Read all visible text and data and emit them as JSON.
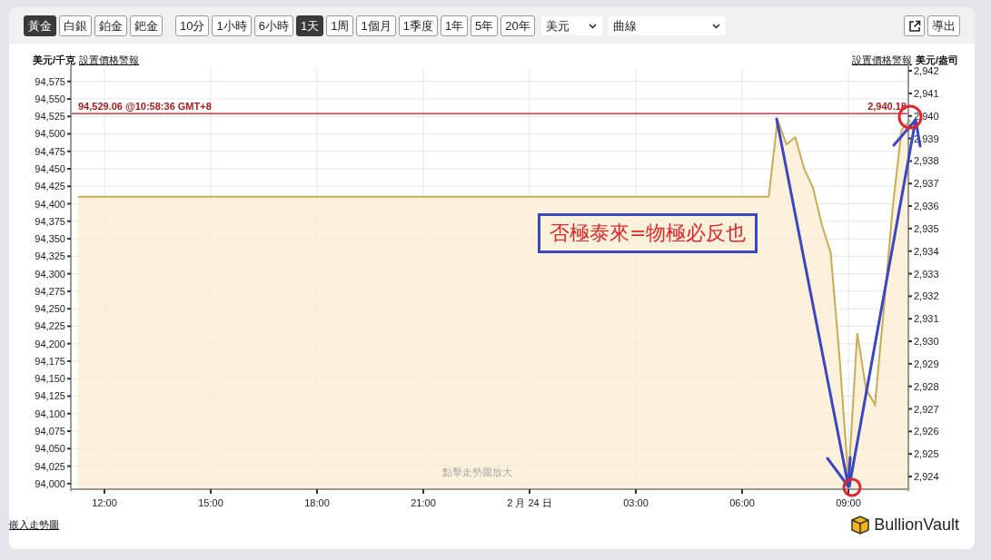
{
  "toolbar": {
    "metals": [
      {
        "label": "黃金",
        "selected": true
      },
      {
        "label": "白銀",
        "selected": false
      },
      {
        "label": "鉑金",
        "selected": false
      },
      {
        "label": "鈀金",
        "selected": false
      }
    ],
    "periods": [
      {
        "label": "10分",
        "selected": false
      },
      {
        "label": "1小時",
        "selected": false
      },
      {
        "label": "6小時",
        "selected": false
      },
      {
        "label": "1天",
        "selected": true
      },
      {
        "label": "1周",
        "selected": false
      },
      {
        "label": "1個月",
        "selected": false
      },
      {
        "label": "1季度",
        "selected": false
      },
      {
        "label": "1年",
        "selected": false
      },
      {
        "label": "5年",
        "selected": false
      },
      {
        "label": "20年",
        "selected": false
      }
    ],
    "currency_select": {
      "value": "美元"
    },
    "chart_type_select": {
      "value": "曲線"
    },
    "export_button": {
      "label": "導出"
    }
  },
  "header": {
    "left_unit": "美元/千克",
    "left_alert_link": "設置價格警報",
    "right_alert_link": "設置價格警報",
    "right_unit": "美元/盎司"
  },
  "chart": {
    "price_line": {
      "right_label": "2,940.18"
    },
    "hint": "點擊走勢圖放大",
    "right_ticks": [
      "2,942",
      "2,941",
      "2,940",
      "2,939",
      "2,938",
      "2,937",
      "2,936",
      "2,935",
      "2,934",
      "2,933",
      "2,932",
      "2,931",
      "2,930",
      "2,929",
      "2,928",
      "2,927",
      "2,926",
      "2,925",
      "2,924"
    ],
    "chart_data": {
      "type": "area",
      "grid": true,
      "ref_lines": [
        {
          "axis": "y",
          "value": 94529.06,
          "label": "94,529.06 @10:58:36 GMT+8",
          "color": "#a61c1c"
        }
      ],
      "categories": [
        null,
        null,
        null,
        "12:00",
        null,
        null,
        null,
        null,
        null,
        null,
        null,
        null,
        null,
        null,
        null,
        "15:00",
        null,
        null,
        null,
        null,
        null,
        null,
        null,
        null,
        null,
        null,
        null,
        "18:00",
        null,
        null,
        null,
        null,
        null,
        null,
        null,
        null,
        null,
        null,
        null,
        "21:00",
        null,
        null,
        null,
        null,
        null,
        null,
        null,
        null,
        null,
        null,
        null,
        "2 月 24 日",
        null,
        null,
        null,
        null,
        null,
        null,
        null,
        null,
        null,
        null,
        null,
        "03:00",
        null,
        null,
        null,
        null,
        null,
        null,
        null,
        null,
        null,
        null,
        null,
        "06:00",
        null,
        null,
        null,
        null,
        null,
        null,
        null,
        null,
        null,
        null,
        null,
        "09:00",
        null,
        null,
        null,
        null,
        null,
        null,
        null
      ],
      "values": [
        94410,
        94410,
        94410,
        94410,
        94410,
        94410,
        94410,
        94410,
        94410,
        94410,
        94410,
        94410,
        94410,
        94410,
        94410,
        94410,
        94410,
        94410,
        94410,
        94410,
        94410,
        94410,
        94410,
        94410,
        94410,
        94410,
        94410,
        94410,
        94410,
        94410,
        94410,
        94410,
        94410,
        94410,
        94410,
        94410,
        94410,
        94410,
        94410,
        94410,
        94410,
        94410,
        94410,
        94410,
        94410,
        94410,
        94410,
        94410,
        94410,
        94410,
        94410,
        94410,
        94410,
        94410,
        94410,
        94410,
        94410,
        94410,
        94410,
        94410,
        94410,
        94410,
        94410,
        94410,
        94410,
        94410,
        94410,
        94410,
        94410,
        94410,
        94410,
        94410,
        94410,
        94410,
        94410,
        94410,
        94410,
        94410,
        94410,
        94520,
        94485,
        94495,
        94450,
        94423,
        94370,
        94330,
        94180,
        94005,
        94215,
        94135,
        94113,
        94250,
        94395,
        94505,
        94520
      ],
      "ylim": [
        93992,
        94594
      ],
      "yticks": [
        {
          "value": 94000,
          "label": "94,000"
        },
        {
          "value": 94025,
          "label": "94,025"
        },
        {
          "value": 94050,
          "label": "94,050"
        },
        {
          "value": 94075,
          "label": "94,075"
        },
        {
          "value": 94100,
          "label": "94,100"
        },
        {
          "value": 94125,
          "label": "94,125"
        },
        {
          "value": 94150,
          "label": "94,150"
        },
        {
          "value": 94175,
          "label": "94,175"
        },
        {
          "value": 94200,
          "label": "94,200"
        },
        {
          "value": 94225,
          "label": "94,225"
        },
        {
          "value": 94250,
          "label": "94,250"
        },
        {
          "value": 94275,
          "label": "94,275"
        },
        {
          "value": 94300,
          "label": "94,300"
        },
        {
          "value": 94325,
          "label": "94,325"
        },
        {
          "value": 94350,
          "label": "94,350"
        },
        {
          "value": 94375,
          "label": "94,375"
        },
        {
          "value": 94400,
          "label": "94,400"
        },
        {
          "value": 94425,
          "label": "94,425"
        },
        {
          "value": 94450,
          "label": "94,450"
        },
        {
          "value": 94475,
          "label": "94,475"
        },
        {
          "value": 94500,
          "label": "94,500"
        },
        {
          "value": 94525,
          "label": "94,525"
        },
        {
          "value": 94550,
          "label": "94,550"
        },
        {
          "value": 94575,
          "label": "94,575"
        }
      ]
    },
    "annotation": {
      "text": "否極泰來=物極必反也"
    }
  },
  "footer": {
    "embed_link": "嵌入走勢圖",
    "logo_text": "BullionVault"
  }
}
